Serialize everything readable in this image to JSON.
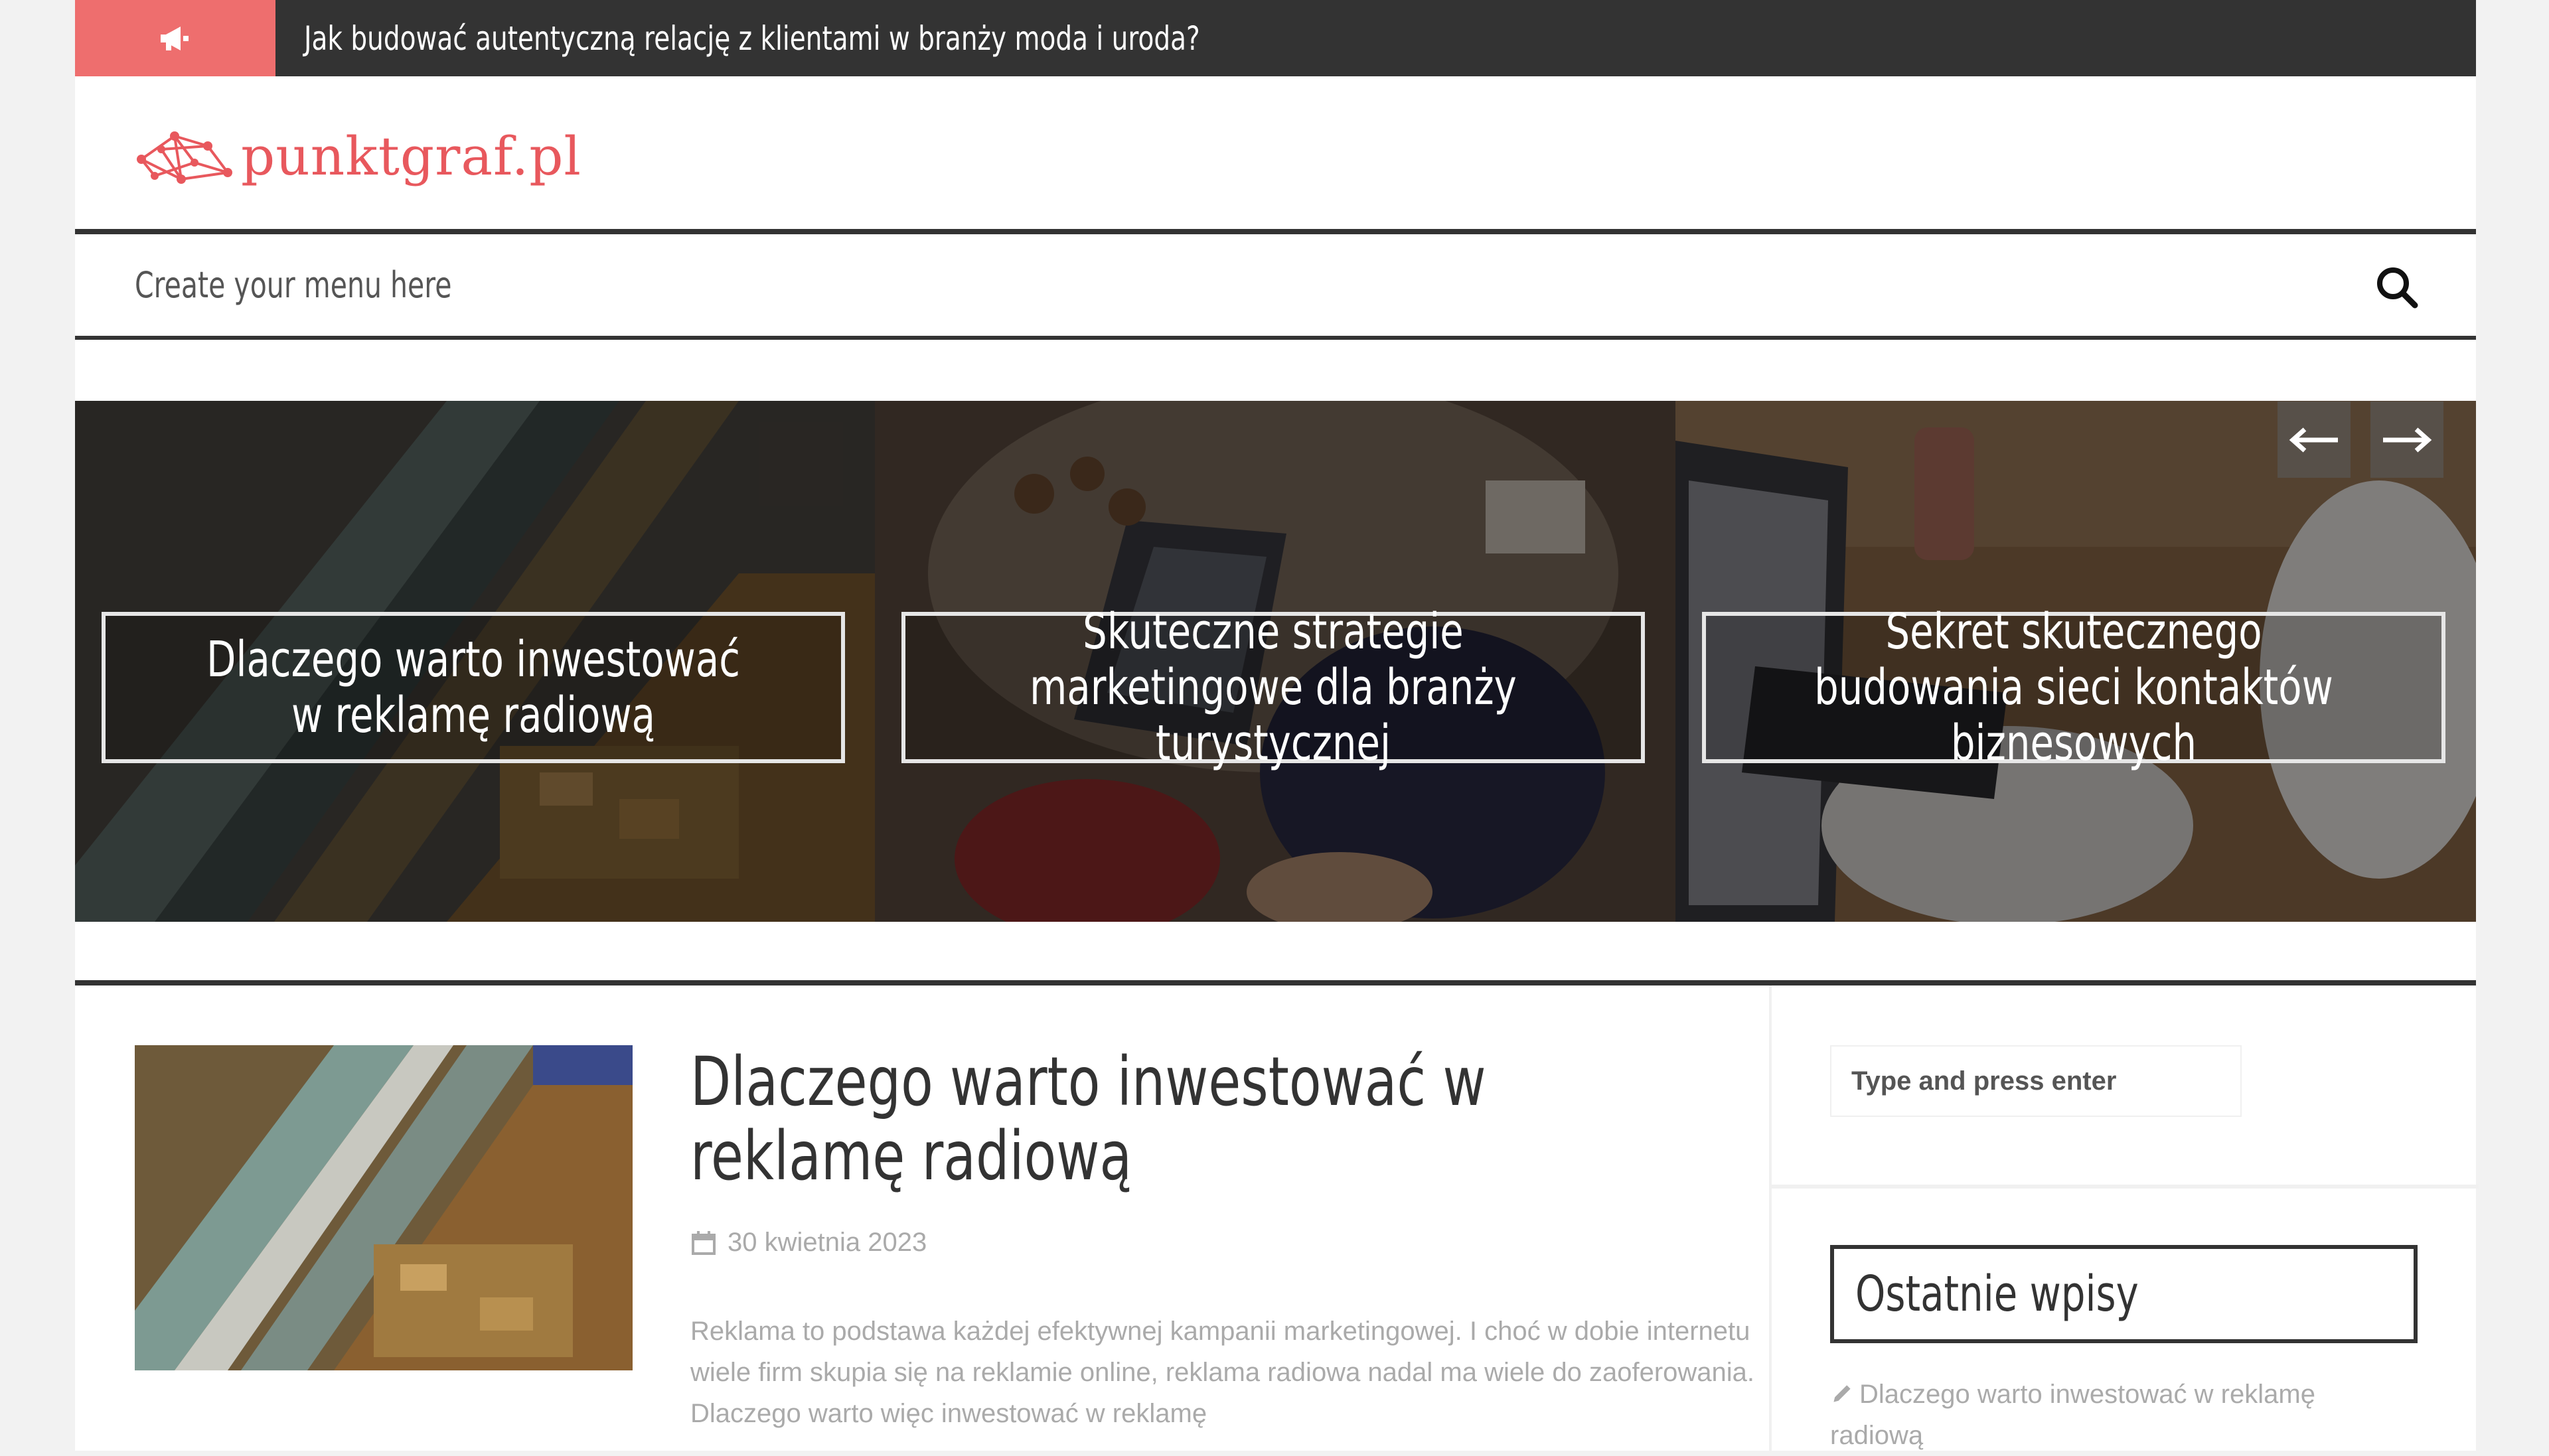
{
  "topbar": {
    "icon": "megaphone-icon",
    "headline": "Jak budować autentyczną relację z klientami w branży moda i uroda?",
    "badge_color": "#ee6e6e",
    "bar_color": "#333333"
  },
  "header": {
    "logo_text": "punktgraf.pl",
    "logo_color": "#e8585d"
  },
  "nav": {
    "placeholder_text": "Create your menu here",
    "search_icon": "search-icon"
  },
  "slider": {
    "slides": [
      {
        "caption": "Dlaczego warto inwestować w reklamę radiową"
      },
      {
        "caption": "Skuteczne strategie marketingowe dla branży turystycznej"
      },
      {
        "caption": "Sekret skutecznego budowania sieci kontaktów biznesowych"
      }
    ],
    "prev_icon": "arrow-left-icon",
    "next_icon": "arrow-right-icon"
  },
  "main": {
    "post": {
      "title": "Dlaczego warto inwestować w reklamę radiową",
      "date": "30 kwietnia 2023",
      "date_icon": "calendar-icon",
      "excerpt": "Reklama to podstawa każdej efektywnej kampanii marketingowej. I choć w dobie internetu wiele firm skupia się na reklamie online, reklama radiowa nadal ma wiele do zaoferowania. Dlaczego warto więc inwestować w reklamę"
    }
  },
  "sidebar": {
    "search_placeholder": "Type and press enter",
    "recent_title": "Ostatnie wpisy",
    "recent_items": [
      {
        "label": "Dlaczego warto inwestować w reklamę radiową",
        "icon": "pencil-icon"
      }
    ]
  }
}
